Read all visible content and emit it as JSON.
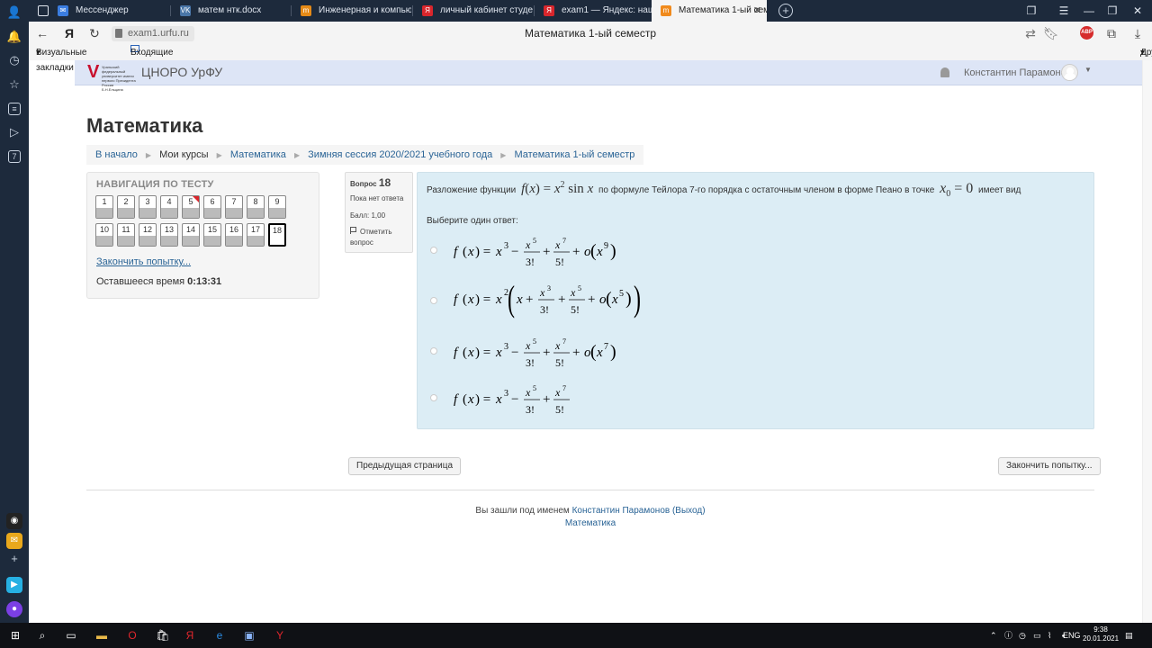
{
  "browser": {
    "tabs": [
      {
        "label": "",
        "icon": "doc-icon"
      },
      {
        "label": "Мессенджер",
        "icon": "messenger-icon"
      },
      {
        "label": "матем нтк.docx",
        "icon": "vk-icon"
      },
      {
        "label": "Инженерная и компьюте",
        "icon": "m-icon"
      },
      {
        "label": "личный кабинет студента",
        "icon": "yandex-icon"
      },
      {
        "label": "exam1 — Яндекс: нашлос",
        "icon": "yandex-icon"
      },
      {
        "label": "Математика 1-ый семе",
        "icon": "moodle-icon",
        "active": true
      }
    ],
    "url": "exam1.urfu.ru",
    "page_title": "Математика 1-ый семестр",
    "abp_label": "ABP",
    "bookmarks": {
      "visual": "Визуальные закладки",
      "inbox": "Входящие • us-66",
      "other": "Другие закладки"
    }
  },
  "header": {
    "site_name": "ЦНОРО УрФУ",
    "logo_text": "Уральский федеральный университет имени первого Президента России Б.Н.Ельцина",
    "user_name": "Константин Парамонов"
  },
  "page": {
    "heading": "Математика",
    "breadcrumbs": {
      "home": "В начало",
      "my_courses": "Мои курсы",
      "course": "Математика",
      "session": "Зимняя сессия 2020/2021 учебного года",
      "section": "Математика 1-ый семестр"
    }
  },
  "quiz_nav": {
    "title": "НАВИГАЦИЯ ПО ТЕСТУ",
    "buttons": [
      "1",
      "2",
      "3",
      "4",
      "5",
      "6",
      "7",
      "8",
      "9",
      "10",
      "11",
      "12",
      "13",
      "14",
      "15",
      "16",
      "17",
      "18"
    ],
    "flagged": "5",
    "current": "18",
    "finish_link": "Закончить попытку...",
    "time_left_label": "Оставшееся время",
    "time_left": "0:13:31"
  },
  "question": {
    "label": "Вопрос",
    "number": "18",
    "status": "Пока нет ответа",
    "points": "Балл: 1,00",
    "flag_label": "Отметить вопрос",
    "text_before": "Разложение функции",
    "func": "f(x) = x² sin x",
    "text_middle": "по формуле Тейлора 7-го порядка с остаточным членом в форме Пеано в точке",
    "point": "x₀ = 0",
    "text_after": "имеет вид",
    "prompt": "Выберите один ответ:",
    "options": [
      "f(x) = x³ − x⁵/3! + x⁷/5! + o(x⁹)",
      "f(x) = x²(x + x³/3! + x⁵/5! + o(x⁵))",
      "f(x) = x³ − x⁵/3! + x⁷/5! + o(x⁷)",
      "f(x) = x³ − x⁵/3! + x⁷/5!"
    ]
  },
  "footer_nav": {
    "prev": "Предыдущая страница",
    "finish": "Закончить попытку..."
  },
  "footer": {
    "logged_in_as": "Вы зашли под именем",
    "user_link": "Константин Парамонов (Выход)",
    "course_link": "Математика"
  },
  "taskbar": {
    "lang": "ENG",
    "time": "9:38",
    "date": "20.01.2021"
  },
  "colors": {
    "question_bg": "#dcedf5",
    "link": "#2a6496",
    "header_bg": "#dde5f6",
    "flag_red": "#d9262c"
  }
}
